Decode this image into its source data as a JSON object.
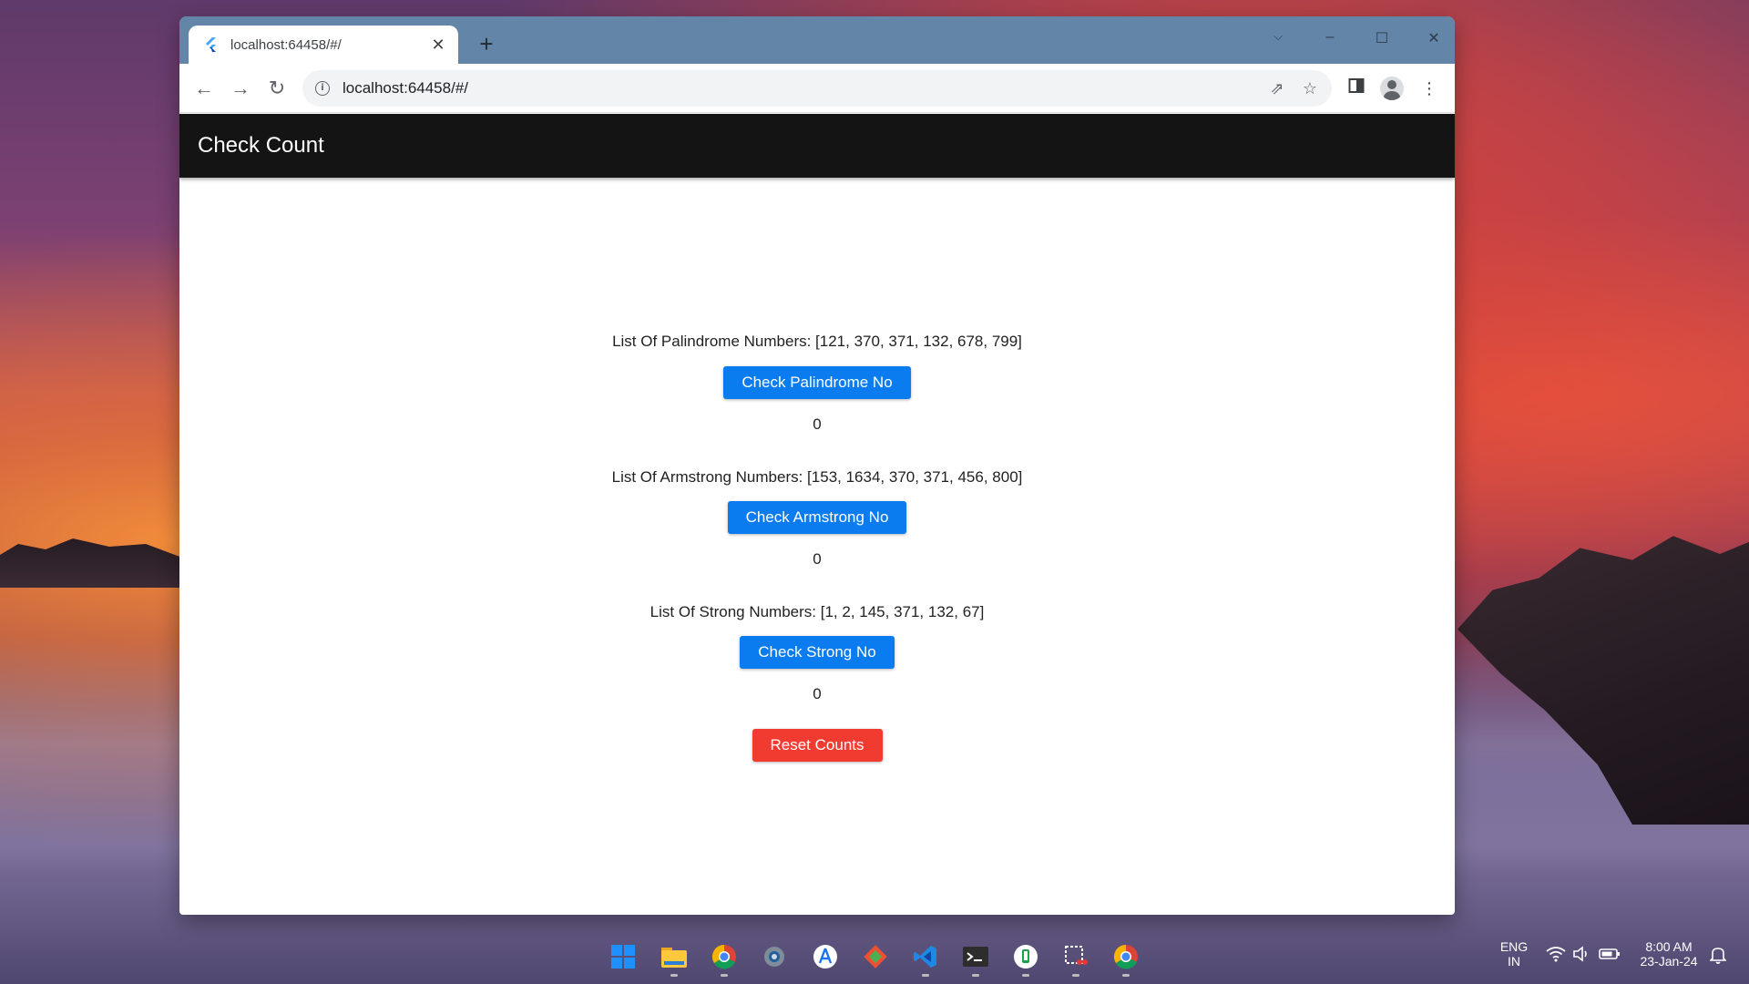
{
  "browser": {
    "tab_title": "localhost:64458/#/",
    "url": "localhost:64458/#/"
  },
  "app": {
    "title": "Check Count",
    "sections": [
      {
        "label": "List Of Palindrome Numbers: [121, 370, 371, 132, 678, 799]",
        "button": "Check Palindrome No",
        "count": "0"
      },
      {
        "label": "List Of Armstrong Numbers: [153, 1634, 370, 371, 456, 800]",
        "button": "Check Armstrong No",
        "count": "0"
      },
      {
        "label": "List Of Strong Numbers: [1, 2, 145, 371, 132, 67]",
        "button": "Check Strong No",
        "count": "0"
      }
    ],
    "reset_button": "Reset Counts",
    "colors": {
      "primary_button": "#0a7cf0",
      "reset_button": "#f23b30",
      "app_bar": "#141414"
    }
  },
  "taskbar": {
    "apps": [
      "windows-start-icon",
      "file-explorer-icon",
      "chrome-icon",
      "settings-icon",
      "app-store-icon",
      "git-icon",
      "vscode-icon",
      "terminal-icon",
      "phone-link-icon",
      "snipping-tool-icon",
      "chrome-icon"
    ],
    "language": "ENG",
    "region": "IN",
    "time": "8:00 AM",
    "date": "23-Jan-24"
  }
}
